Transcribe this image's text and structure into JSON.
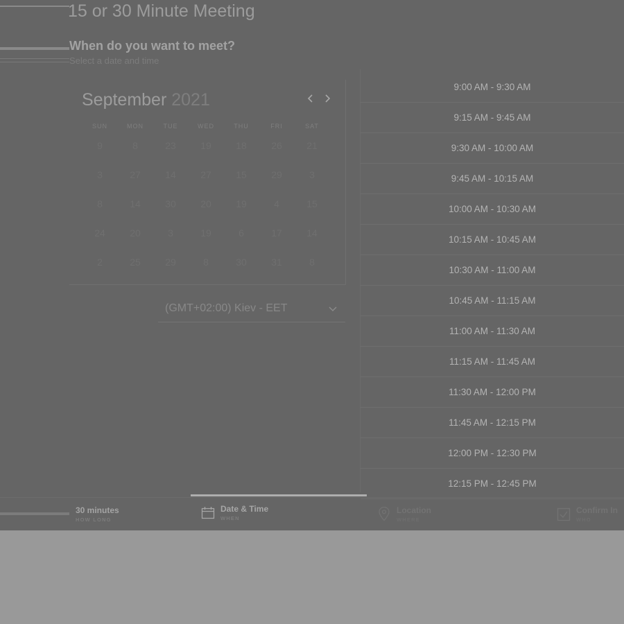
{
  "meeting": {
    "title": "15 or 30 Minute Meeting",
    "question": "When do you want to meet?",
    "instruction": "Select a date and time"
  },
  "calendar": {
    "month": "September",
    "year": "2021",
    "prev_icon": "chevron-left-icon",
    "next_icon": "chevron-right-icon",
    "weekdays": [
      "SUN",
      "MON",
      "TUE",
      "WED",
      "THU",
      "FRI",
      "SAT"
    ],
    "weeks": [
      [
        "9",
        "8",
        "23",
        "19",
        "18",
        "26",
        "21"
      ],
      [
        "3",
        "27",
        "14",
        "27",
        "15",
        "29",
        "3"
      ],
      [
        "8",
        "14",
        "30",
        "20",
        "19",
        "4",
        "15"
      ],
      [
        "24",
        "20",
        "3",
        "19",
        "6",
        "17",
        "14"
      ],
      [
        "2",
        "25",
        "29",
        "8",
        "30",
        "31",
        "8"
      ]
    ]
  },
  "timezone": {
    "label": "(GMT+02:00) Kiev - EET",
    "icon": "chevron-down-icon"
  },
  "time_slots": [
    "9:00 AM - 9:30 AM",
    "9:15 AM - 9:45 AM",
    "9:30 AM - 10:00 AM",
    "9:45 AM - 10:15 AM",
    "10:00 AM - 10:30 AM",
    "10:15 AM - 10:45 AM",
    "10:30 AM - 11:00 AM",
    "10:45 AM - 11:15 AM",
    "11:00 AM - 11:30 AM",
    "11:15 AM - 11:45 AM",
    "11:30 AM - 12:00 PM",
    "11:45 AM - 12:15 PM",
    "12:00 PM - 12:30 PM",
    "12:15 PM - 12:45 PM"
  ],
  "steps": [
    {
      "title": "30 minutes",
      "sub": "HOW LONG",
      "icon": ""
    },
    {
      "title": "Date & Time",
      "sub": "WHEN",
      "icon": "calendar-icon"
    },
    {
      "title": "Location",
      "sub": "WHERE",
      "icon": "map-pin-icon"
    },
    {
      "title": "Confirm In",
      "sub": "WHO",
      "icon": "checkbox-icon"
    }
  ],
  "colors": {
    "overlay": "#656565",
    "page_background": "#999999",
    "active_step_underline": "#aeaeae"
  }
}
